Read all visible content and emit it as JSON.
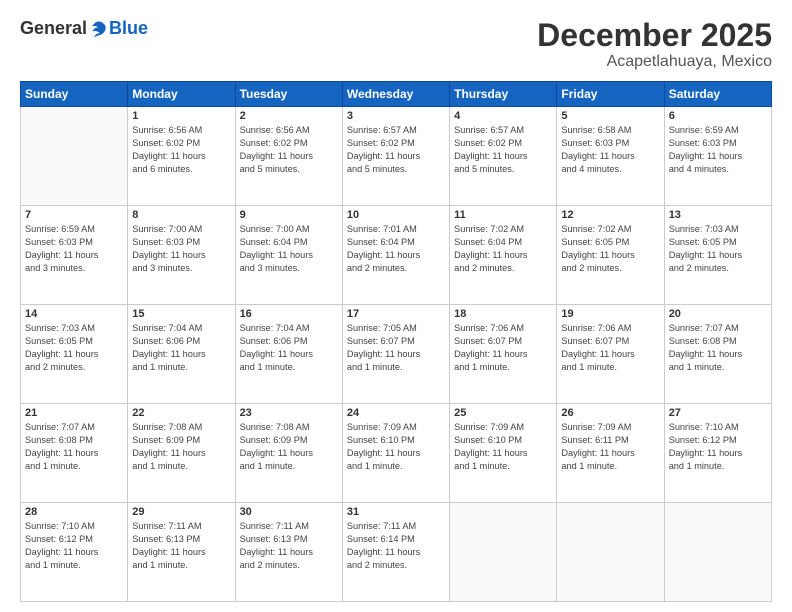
{
  "logo": {
    "general": "General",
    "blue": "Blue"
  },
  "header": {
    "month": "December 2025",
    "location": "Acapetlahuaya, Mexico"
  },
  "weekdays": [
    "Sunday",
    "Monday",
    "Tuesday",
    "Wednesday",
    "Thursday",
    "Friday",
    "Saturday"
  ],
  "weeks": [
    [
      {
        "day": "",
        "info": ""
      },
      {
        "day": "1",
        "info": "Sunrise: 6:56 AM\nSunset: 6:02 PM\nDaylight: 11 hours\nand 6 minutes."
      },
      {
        "day": "2",
        "info": "Sunrise: 6:56 AM\nSunset: 6:02 PM\nDaylight: 11 hours\nand 5 minutes."
      },
      {
        "day": "3",
        "info": "Sunrise: 6:57 AM\nSunset: 6:02 PM\nDaylight: 11 hours\nand 5 minutes."
      },
      {
        "day": "4",
        "info": "Sunrise: 6:57 AM\nSunset: 6:02 PM\nDaylight: 11 hours\nand 5 minutes."
      },
      {
        "day": "5",
        "info": "Sunrise: 6:58 AM\nSunset: 6:03 PM\nDaylight: 11 hours\nand 4 minutes."
      },
      {
        "day": "6",
        "info": "Sunrise: 6:59 AM\nSunset: 6:03 PM\nDaylight: 11 hours\nand 4 minutes."
      }
    ],
    [
      {
        "day": "7",
        "info": "Sunrise: 6:59 AM\nSunset: 6:03 PM\nDaylight: 11 hours\nand 3 minutes."
      },
      {
        "day": "8",
        "info": "Sunrise: 7:00 AM\nSunset: 6:03 PM\nDaylight: 11 hours\nand 3 minutes."
      },
      {
        "day": "9",
        "info": "Sunrise: 7:00 AM\nSunset: 6:04 PM\nDaylight: 11 hours\nand 3 minutes."
      },
      {
        "day": "10",
        "info": "Sunrise: 7:01 AM\nSunset: 6:04 PM\nDaylight: 11 hours\nand 2 minutes."
      },
      {
        "day": "11",
        "info": "Sunrise: 7:02 AM\nSunset: 6:04 PM\nDaylight: 11 hours\nand 2 minutes."
      },
      {
        "day": "12",
        "info": "Sunrise: 7:02 AM\nSunset: 6:05 PM\nDaylight: 11 hours\nand 2 minutes."
      },
      {
        "day": "13",
        "info": "Sunrise: 7:03 AM\nSunset: 6:05 PM\nDaylight: 11 hours\nand 2 minutes."
      }
    ],
    [
      {
        "day": "14",
        "info": "Sunrise: 7:03 AM\nSunset: 6:05 PM\nDaylight: 11 hours\nand 2 minutes."
      },
      {
        "day": "15",
        "info": "Sunrise: 7:04 AM\nSunset: 6:06 PM\nDaylight: 11 hours\nand 1 minute."
      },
      {
        "day": "16",
        "info": "Sunrise: 7:04 AM\nSunset: 6:06 PM\nDaylight: 11 hours\nand 1 minute."
      },
      {
        "day": "17",
        "info": "Sunrise: 7:05 AM\nSunset: 6:07 PM\nDaylight: 11 hours\nand 1 minute."
      },
      {
        "day": "18",
        "info": "Sunrise: 7:06 AM\nSunset: 6:07 PM\nDaylight: 11 hours\nand 1 minute."
      },
      {
        "day": "19",
        "info": "Sunrise: 7:06 AM\nSunset: 6:07 PM\nDaylight: 11 hours\nand 1 minute."
      },
      {
        "day": "20",
        "info": "Sunrise: 7:07 AM\nSunset: 6:08 PM\nDaylight: 11 hours\nand 1 minute."
      }
    ],
    [
      {
        "day": "21",
        "info": "Sunrise: 7:07 AM\nSunset: 6:08 PM\nDaylight: 11 hours\nand 1 minute."
      },
      {
        "day": "22",
        "info": "Sunrise: 7:08 AM\nSunset: 6:09 PM\nDaylight: 11 hours\nand 1 minute."
      },
      {
        "day": "23",
        "info": "Sunrise: 7:08 AM\nSunset: 6:09 PM\nDaylight: 11 hours\nand 1 minute."
      },
      {
        "day": "24",
        "info": "Sunrise: 7:09 AM\nSunset: 6:10 PM\nDaylight: 11 hours\nand 1 minute."
      },
      {
        "day": "25",
        "info": "Sunrise: 7:09 AM\nSunset: 6:10 PM\nDaylight: 11 hours\nand 1 minute."
      },
      {
        "day": "26",
        "info": "Sunrise: 7:09 AM\nSunset: 6:11 PM\nDaylight: 11 hours\nand 1 minute."
      },
      {
        "day": "27",
        "info": "Sunrise: 7:10 AM\nSunset: 6:12 PM\nDaylight: 11 hours\nand 1 minute."
      }
    ],
    [
      {
        "day": "28",
        "info": "Sunrise: 7:10 AM\nSunset: 6:12 PM\nDaylight: 11 hours\nand 1 minute."
      },
      {
        "day": "29",
        "info": "Sunrise: 7:11 AM\nSunset: 6:13 PM\nDaylight: 11 hours\nand 1 minute."
      },
      {
        "day": "30",
        "info": "Sunrise: 7:11 AM\nSunset: 6:13 PM\nDaylight: 11 hours\nand 2 minutes."
      },
      {
        "day": "31",
        "info": "Sunrise: 7:11 AM\nSunset: 6:14 PM\nDaylight: 11 hours\nand 2 minutes."
      },
      {
        "day": "",
        "info": ""
      },
      {
        "day": "",
        "info": ""
      },
      {
        "day": "",
        "info": ""
      }
    ]
  ]
}
